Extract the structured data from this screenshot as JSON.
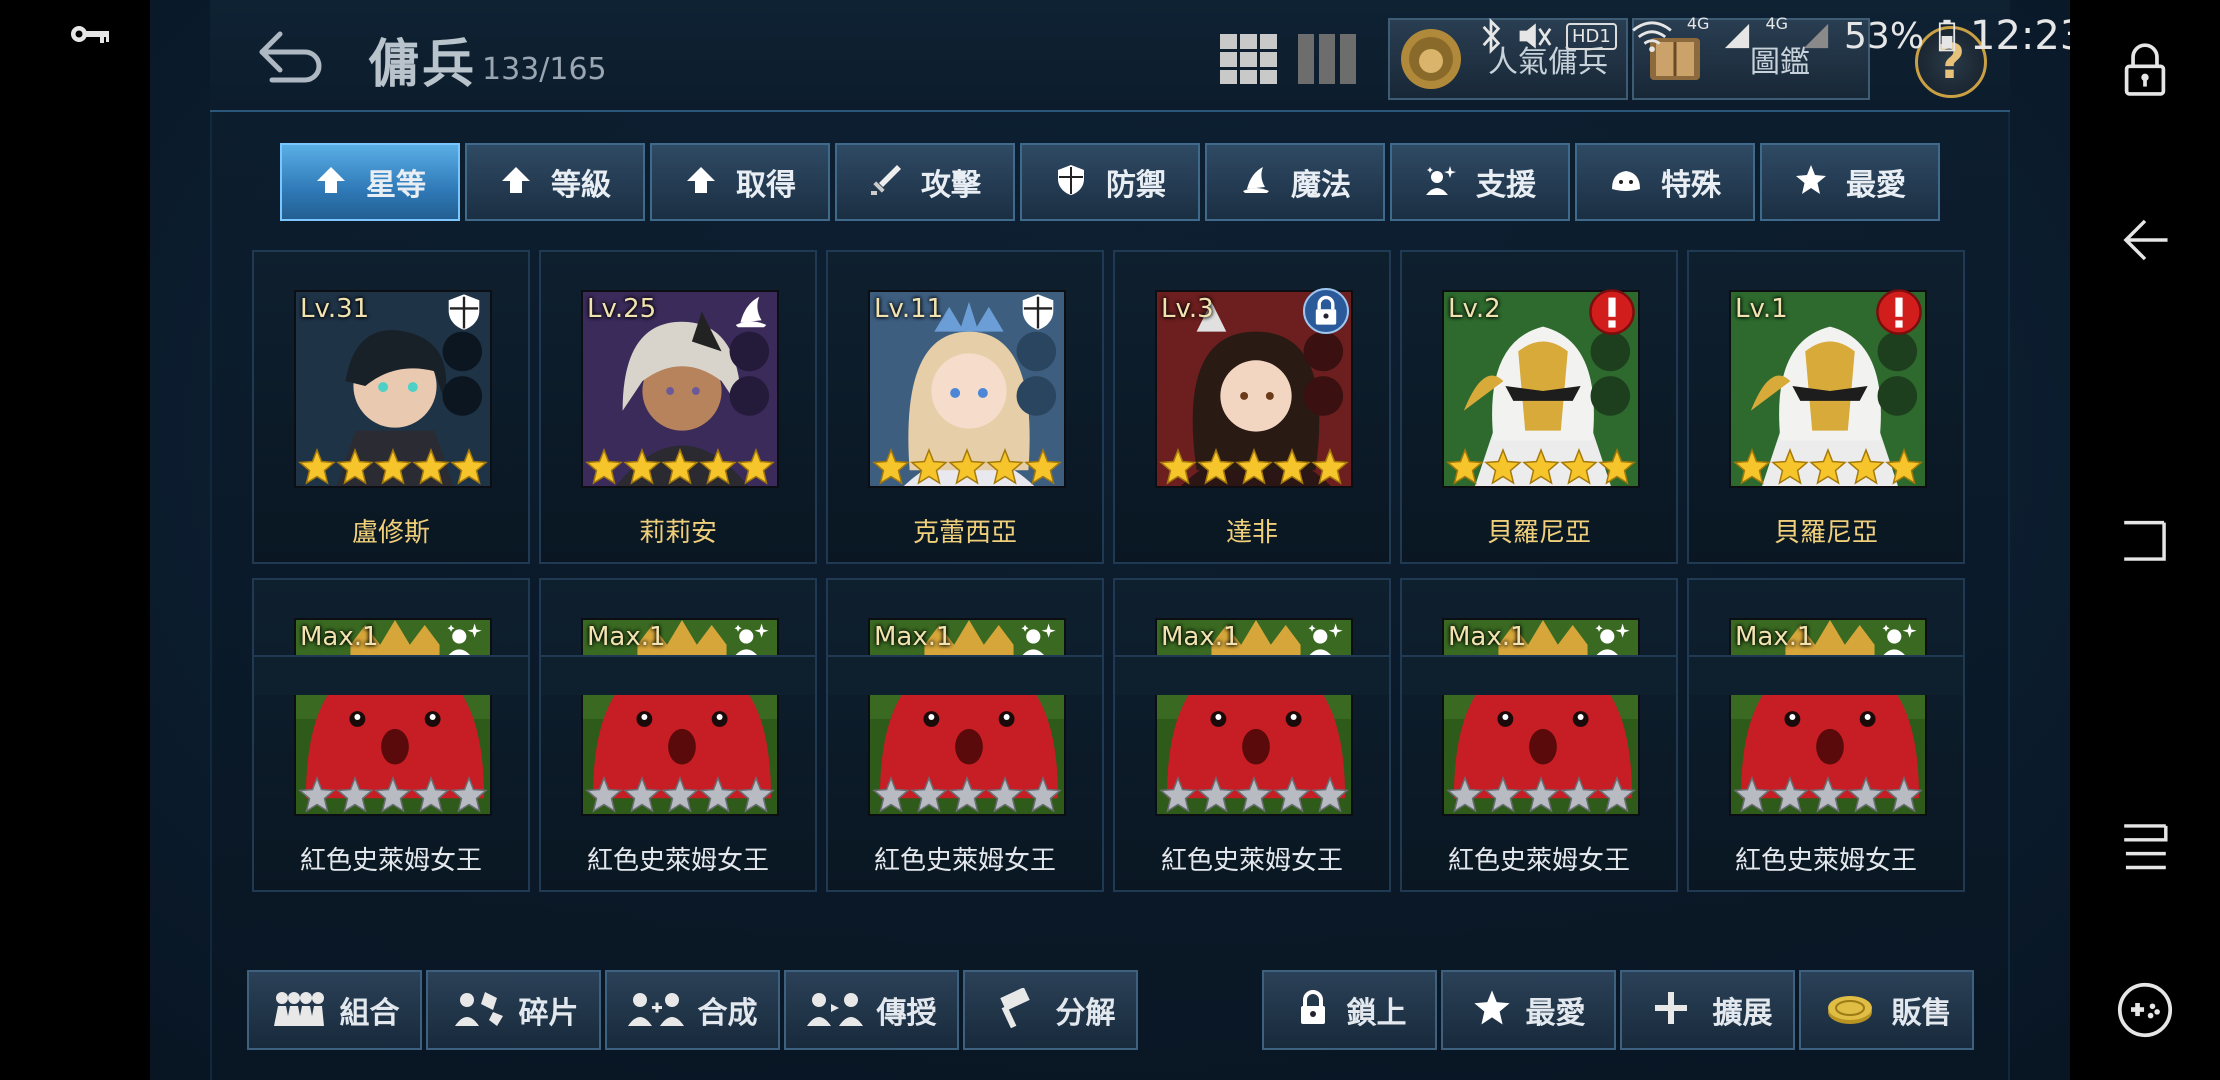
{
  "header": {
    "title": "傭兵",
    "count": "133/165",
    "popular_label": "人氣傭兵",
    "codex_label": "圖鑑",
    "help_label": "?"
  },
  "status_bar": {
    "battery": "53%",
    "time": "12:23",
    "network_1": "4G",
    "network_2": "4G",
    "hd_badge": "HD1"
  },
  "tabs": [
    {
      "label": "星等",
      "icon": "arrow-up-icon",
      "active": true
    },
    {
      "label": "等級",
      "icon": "arrow-up-icon",
      "active": false
    },
    {
      "label": "取得",
      "icon": "arrow-up-icon",
      "active": false
    },
    {
      "label": "攻擊",
      "icon": "sword-icon",
      "active": false
    },
    {
      "label": "防禦",
      "icon": "shield-icon",
      "active": false
    },
    {
      "label": "魔法",
      "icon": "wizard-hat-icon",
      "active": false
    },
    {
      "label": "支援",
      "icon": "support-icon",
      "active": false
    },
    {
      "label": "特殊",
      "icon": "slime-icon",
      "active": false
    },
    {
      "label": "最愛",
      "icon": "star-icon",
      "active": false
    }
  ],
  "cards": [
    {
      "level": "Lv.31",
      "name": "盧修斯",
      "class_icon": "shield-icon",
      "badge": "",
      "stars": "gold",
      "portrait": "dark-hair-knight",
      "name_color": "gold"
    },
    {
      "level": "Lv.25",
      "name": "莉莉安",
      "class_icon": "wizard-hat-icon",
      "badge": "",
      "stars": "gold",
      "portrait": "silver-hair-mage",
      "name_color": "gold"
    },
    {
      "level": "Lv.11",
      "name": "克蕾西亞",
      "class_icon": "shield-icon",
      "badge": "",
      "stars": "gold",
      "portrait": "blonde-princess",
      "name_color": "gold"
    },
    {
      "level": "Lv.3",
      "name": "達非",
      "class_icon": "",
      "badge": "lock-icon",
      "stars": "gold",
      "portrait": "dark-hair-girl",
      "name_color": "gold"
    },
    {
      "level": "Lv.2",
      "name": "貝羅尼亞",
      "class_icon": "",
      "badge": "alert-icon",
      "stars": "gold",
      "portrait": "golden-helmet",
      "name_color": "gold"
    },
    {
      "level": "Lv.1",
      "name": "貝羅尼亞",
      "class_icon": "",
      "badge": "alert-icon",
      "stars": "gold",
      "portrait": "golden-helmet",
      "name_color": "gold"
    },
    {
      "level": "Max.1",
      "name": "紅色史萊姆女王",
      "class_icon": "support-icon",
      "badge": "",
      "stars": "silver",
      "portrait": "red-slime",
      "name_color": "white"
    },
    {
      "level": "Max.1",
      "name": "紅色史萊姆女王",
      "class_icon": "support-icon",
      "badge": "",
      "stars": "silver",
      "portrait": "red-slime",
      "name_color": "white"
    },
    {
      "level": "Max.1",
      "name": "紅色史萊姆女王",
      "class_icon": "support-icon",
      "badge": "",
      "stars": "silver",
      "portrait": "red-slime",
      "name_color": "white"
    },
    {
      "level": "Max.1",
      "name": "紅色史萊姆女王",
      "class_icon": "support-icon",
      "badge": "",
      "stars": "silver",
      "portrait": "red-slime",
      "name_color": "white"
    },
    {
      "level": "Max.1",
      "name": "紅色史萊姆女王",
      "class_icon": "support-icon",
      "badge": "",
      "stars": "silver",
      "portrait": "red-slime",
      "name_color": "white"
    },
    {
      "level": "Max.1",
      "name": "紅色史萊姆女王",
      "class_icon": "support-icon",
      "badge": "",
      "stars": "silver",
      "portrait": "red-slime",
      "name_color": "white"
    }
  ],
  "bottom_left": [
    {
      "label": "組合",
      "icon": "team-icon"
    },
    {
      "label": "碎片",
      "icon": "fragment-icon"
    },
    {
      "label": "合成",
      "icon": "merge-icon"
    },
    {
      "label": "傳授",
      "icon": "transfer-icon"
    },
    {
      "label": "分解",
      "icon": "hammer-icon"
    }
  ],
  "bottom_right": [
    {
      "label": "鎖上",
      "icon": "lock-icon"
    },
    {
      "label": "最愛",
      "icon": "star-icon"
    },
    {
      "label": "擴展",
      "icon": "plus-icon"
    },
    {
      "label": "販售",
      "icon": "coin-icon"
    }
  ],
  "colors": {
    "accent_blue": "#4aa2e0",
    "gold_text": "#efcf7a",
    "star_gold": "#f6c52c",
    "star_silver": "#b8bcc2",
    "alert_red": "#d21d1d"
  }
}
